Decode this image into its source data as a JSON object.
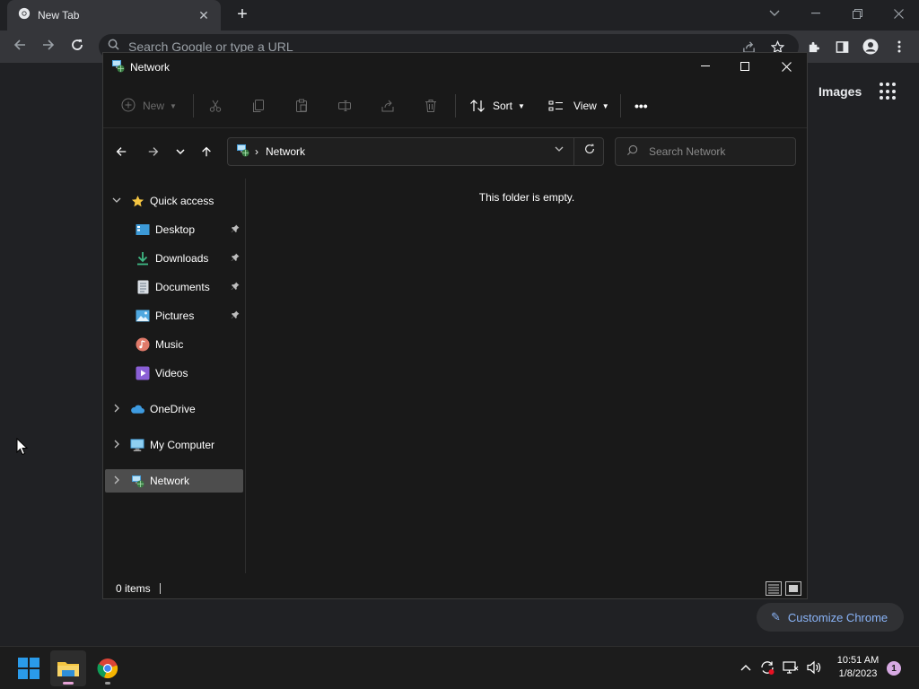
{
  "chrome": {
    "tab_title": "New Tab",
    "tab_close": "✕",
    "new_tab": "+",
    "omnibox_placeholder": "Search Google or type a URL",
    "images_link": "Images",
    "customize_label": "Customize Chrome"
  },
  "explorer": {
    "title": "Network",
    "cmdbar": {
      "new_label": "New",
      "sort_label": "Sort",
      "view_label": "View",
      "more_label": "•••"
    },
    "address": {
      "crumb": "Network"
    },
    "search_placeholder": "Search Network",
    "nav": {
      "quick_access": "Quick access",
      "desktop": "Desktop",
      "downloads": "Downloads",
      "documents": "Documents",
      "pictures": "Pictures",
      "music": "Music",
      "videos": "Videos",
      "onedrive": "OneDrive",
      "my_computer": "My Computer",
      "network": "Network"
    },
    "empty_message": "This folder is empty.",
    "status_items": "0 items"
  },
  "taskbar": {
    "time": "10:51 AM",
    "date": "1/8/2023",
    "notification_count": "1"
  },
  "colors": {
    "desktop_bg": "#202124",
    "explorer_bg": "#191919",
    "accent_link": "#8ab4f8",
    "selection": "#4d4d4d",
    "folder_yellow": "#f4c542"
  }
}
